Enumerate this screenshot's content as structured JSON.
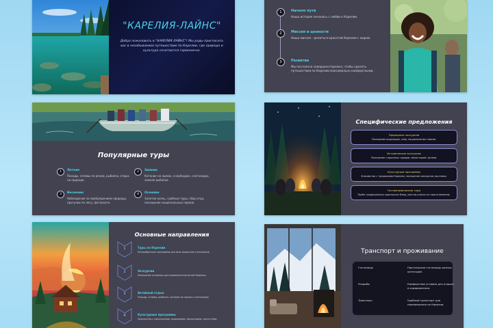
{
  "slide1": {
    "title": "\"КАРЕЛИЯ-ЛАЙНС\"",
    "text": "Добро пожаловать в \"КАРЕЛИЯ-ЛАЙНС\"! Мы рады пригласить вас в незабываемое путешествие по Карелии, где природа и культура сочетаются гармонично."
  },
  "slide2": {
    "items": [
      {
        "num": "1",
        "heading": "Начало пути",
        "text": "Наша история началась с любви к Карелии."
      },
      {
        "num": "2",
        "heading": "Миссия и ценности",
        "text": "Наша миссия - делиться красотой Карелии с миром."
      },
      {
        "num": "3",
        "heading": "Развитие",
        "text": "Мы постоянно совершенствуемся, чтобы сделать путешествия по Карелии максимально комфортными."
      }
    ]
  },
  "slide3": {
    "title": "Популярные туры",
    "tours": [
      {
        "num": "1",
        "heading": "Летние",
        "text": "Походы, сплавы по рекам, рыбалка, отдых на природе."
      },
      {
        "num": "2",
        "heading": "Зимние",
        "text": "Катание на лыжах, сноубордах, снегоходах, зимняя рыбалка."
      },
      {
        "num": "3",
        "heading": "Весенние",
        "text": "Наблюдение за пробуждением природы, прогулки по лесу, фотоохота."
      },
      {
        "num": "4",
        "heading": "Осенние",
        "text": "Золотая осень, грибные туры, сбор ягод, посещение национальных парков."
      }
    ]
  },
  "slide4": {
    "title": "Специфические предложения",
    "offers": [
      {
        "heading": "Природные экскурсии",
        "text": "Посещение водопадов, озёр, национальных парков."
      },
      {
        "heading": "Исторические экскурсии",
        "text": "Посещение старинных городов, монастырей, музеев."
      },
      {
        "heading": "Культурные программы",
        "text": "Знакомство с традициями Карелии, посещение концертов, выставок."
      },
      {
        "heading": "Гастрономические туры",
        "text": "Проба традиционных карельских блюд, мастер-классы по приготовлению."
      }
    ]
  },
  "slide5": {
    "title": "Основные направления",
    "items": [
      {
        "num": "1",
        "heading": "Туры по Карелии",
        "text": "Разнообразные программы для всех возрастов и интересов."
      },
      {
        "num": "2",
        "heading": "Экскурсии",
        "text": "Посещение основных достопримечательностей Карелии."
      },
      {
        "num": "3",
        "heading": "Активный отдых",
        "text": "Походы, сплавы, рыбалка, катание на лыжах и снегоходах."
      },
      {
        "num": "4",
        "heading": "Культурные программы",
        "text": "Знакомство с карельскими традициями, фольклором, искусством."
      }
    ]
  },
  "slide6": {
    "title": "Транспорт и проживание",
    "rows": [
      {
        "key": "Гостиницы",
        "value": "Партнерские гостиницы разных категорий."
      },
      {
        "key": "Усадьбы",
        "value": "Комфортные условия для отдыха и оздоровления."
      },
      {
        "key": "Транспорт",
        "value": "Удобный транспорт для перемещения по Карелии."
      }
    ]
  },
  "colors": {
    "accent": "#4fd1e8",
    "background": "#434250",
    "page": "#b2e2f8"
  },
  "icons": [
    "lake-photo",
    "hikers-photo",
    "boat-photo",
    "campfire-photo",
    "cabin-sunset-art",
    "fireplace-window-photo"
  ]
}
